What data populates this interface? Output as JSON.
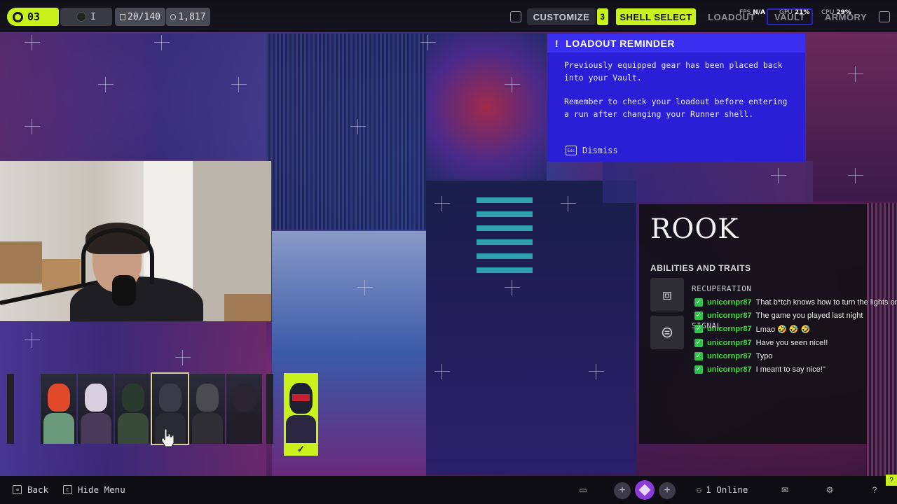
{
  "topbar": {
    "level": "03",
    "rank": "I",
    "counter": "20/140",
    "credits": "1,817",
    "nav": {
      "customize": "CUSTOMIZE",
      "customize_badge": "3",
      "shell_select": "SHELL SELECT",
      "loadout": "LOADOUT",
      "vault": "VAULT",
      "armory": "ARMORY"
    },
    "perf": {
      "fps_label": "FPS",
      "fps_value": "N/A",
      "gpu_label": "GPU",
      "gpu_value": "21%",
      "cpu_label": "CPU",
      "cpu_value": "29%"
    }
  },
  "reminder": {
    "title": "LOADOUT REMINDER",
    "paragraph1": "Previously equipped gear has been placed back into your Vault.",
    "paragraph2": "Remember to check your loadout before entering a run after changing your Runner shell.",
    "dismiss_key": "Esc",
    "dismiss_label": "Dismiss"
  },
  "shell_panel": {
    "name": "ROOK",
    "abilities_title": "ABILITIES AND TRAITS",
    "abilities": [
      {
        "name": "RECUPERATION",
        "icon": "recuperation-icon"
      },
      {
        "name": "SIGNAL",
        "icon": "signal-icon"
      }
    ]
  },
  "roster": [
    {
      "icon": "shell-portrait-icon",
      "colors": [
        "#e04a2a",
        "#6a9a7a"
      ]
    },
    {
      "icon": "shell-portrait-icon",
      "colors": [
        "#d8d0e0",
        "#4a3a5a"
      ]
    },
    {
      "icon": "shell-portrait-icon",
      "colors": [
        "#2a3a2e",
        "#3a4a3a"
      ]
    },
    {
      "icon": "shell-portrait-icon",
      "colors": [
        "#3a3a48",
        "#2a2a34"
      ]
    },
    {
      "icon": "shell-portrait-icon",
      "colors": [
        "#4a4a50",
        "#2e2e34"
      ]
    },
    {
      "icon": "shell-portrait-icon",
      "colors": [
        "#2a2430",
        "#221e28"
      ]
    }
  ],
  "chat": [
    {
      "user": "unicornpr87",
      "message": "That b*tch knows how to turn the lights on"
    },
    {
      "user": "unicornpr87",
      "message": "The game you played last night"
    },
    {
      "user": "unicornpr87",
      "message": "Lmao 🤣 🤣 🤣"
    },
    {
      "user": "unicornpr87",
      "message": "Have you seen nice!!"
    },
    {
      "user": "unicornpr87",
      "message": "Typo"
    },
    {
      "user": "unicornpr87",
      "message": "I meant to say nice!\""
    }
  ],
  "bottombar": {
    "back_key": "⌫",
    "back_label": "Back",
    "hide_key": "C",
    "hide_label": "Hide Menu",
    "online": "1 Online"
  },
  "colors": {
    "accent": "#c9f21c",
    "reminder_bg": "#2a1fd6",
    "chat_user": "#3ddc3d"
  }
}
